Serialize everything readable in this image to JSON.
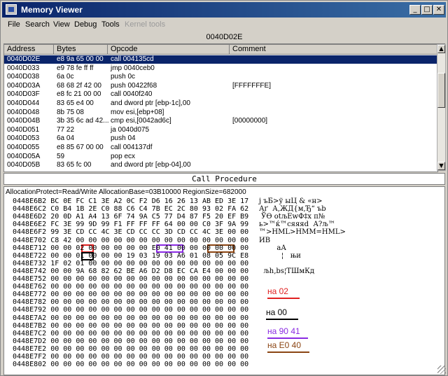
{
  "window": {
    "title": "Memory Viewer",
    "buttons": [
      "_",
      "□",
      "✕"
    ]
  },
  "menu": [
    "File",
    "Search",
    "View",
    "Debug",
    "Tools",
    "Kernel tools"
  ],
  "address_bar": "0040D02E",
  "disasm": {
    "columns": [
      "Address",
      "Bytes",
      "Opcode",
      "Comment"
    ],
    "rows": [
      {
        "addr": "0040D02E",
        "bytes": "e8 9a 65 00 00",
        "op": "call 004135cd",
        "comment": "",
        "selected": true
      },
      {
        "addr": "0040D033",
        "bytes": "e9 78 fe ff ff",
        "op": "jmp 0040ceb0",
        "comment": ""
      },
      {
        "addr": "0040D038",
        "bytes": "6a 0c",
        "op": "push 0c",
        "comment": ""
      },
      {
        "addr": "0040D03A",
        "bytes": "68 68 2f 42 00",
        "op": "push 00422f68",
        "comment": "[FFFFFFFE]"
      },
      {
        "addr": "0040D03F",
        "bytes": "e8 fc 21 00 00",
        "op": "call 0040f240",
        "comment": ""
      },
      {
        "addr": "0040D044",
        "bytes": "83 65 e4 00",
        "op": "and dword ptr [ebp-1c],00",
        "comment": ""
      },
      {
        "addr": "0040D048",
        "bytes": "8b 75 08",
        "op": "mov esi,[ebp+08]",
        "comment": ""
      },
      {
        "addr": "0040D04B",
        "bytes": "3b 35 6c ad 42...",
        "op": "cmp esi,[0042ad6c]",
        "comment": "[00000000]"
      },
      {
        "addr": "0040D051",
        "bytes": "77 22",
        "op": "ja 0040d075",
        "comment": ""
      },
      {
        "addr": "0040D053",
        "bytes": "6a 04",
        "op": "push 04",
        "comment": ""
      },
      {
        "addr": "0040D055",
        "bytes": "e8 85 67 00 00",
        "op": "call 004137df",
        "comment": ""
      },
      {
        "addr": "0040D05A",
        "bytes": "59",
        "op": "pop ecx",
        "comment": ""
      },
      {
        "addr": "0040D05B",
        "bytes": "83 65 fc 00",
        "op": "and dword ptr [ebp-04],00",
        "comment": ""
      }
    ]
  },
  "call_procedure": "Call Procedure",
  "alloc_info": "AllocationProtect=Read/Write  AllocationBase=03B10000 RegionSize=682000",
  "hex_rows": [
    {
      "addr": "0448E6B2",
      "hex": "BC 0E FC C1 3E A2 0C F2 D6 16 26 13 AB ED 3E 17",
      "ascii": "j ъБ>ў ыЦ & «н>"
    },
    {
      "addr": "0448E6C2",
      "hex": "C0 B4 1B 2E C0 88 C6 C4 7B EC 2C 80 93 02 FA 62",
      "ascii": "Аґ  А‚ЖД{м,Ђ“ ъb"
    },
    {
      "addr": "0448E6D2",
      "hex": "20 0D A1 A4 13 6F 74 9A C5 77 D4 87 F5 20 EF B9",
      "ascii": " ЎӨ otљЕwФ‡х п№"
    },
    {
      "addr": "0448E6E2",
      "hex": "FC 3E 99 9D 99 F1 FF FF FF 64 00 00 C0 3F 9A 99",
      "ascii": "ь>™ќ™сяяяd  А?љ™"
    },
    {
      "addr": "0448E6F2",
      "hex": "99 3E CD CC 4C 3E CD CC CC 3D CD CC 4C 3E 00 00",
      "ascii": "™>НМL>НММ=НМL>"
    },
    {
      "addr": "0448E702",
      "hex": "C8 42 00 00 00 00 00 00 00 00 00 00 00 00 00 00",
      "ascii": "ИВ"
    },
    {
      "addr": "0448E712",
      "hex": "00 00 02 00 00 00 00 00 E0 41 00 00 00 00 00 00",
      "ascii": "        аА"
    },
    {
      "addr": "0448E722",
      "hex": "00 00 01 00 00 00 19 03 19 03 A6 01 08 05 9C E8",
      "ascii": "          ¦   њи"
    },
    {
      "addr": "0448E732",
      "hex": "1F 02 01 00 00 00 00 00 00 00 00 00 00 00 00 00",
      "ascii": ""
    },
    {
      "addr": "0448E742",
      "hex": "00 00 9A 68 82 62 BE A6 D2 D8 EC CA E4 00 00 00",
      "ascii": "  љh‚bѕ¦ТШмКд"
    },
    {
      "addr": "0448E752",
      "hex": "00 00 00 00 00 00 00 00 00 00 00 00 00 00 00 00",
      "ascii": ""
    },
    {
      "addr": "0448E762",
      "hex": "00 00 00 00 00 00 00 00 00 00 00 00 00 00 00 00",
      "ascii": ""
    },
    {
      "addr": "0448E772",
      "hex": "00 00 00 00 00 00 00 00 00 00 00 00 00 00 00 00",
      "ascii": ""
    },
    {
      "addr": "0448E782",
      "hex": "00 00 00 00 00 00 00 00 00 00 00 00 00 00 00 00",
      "ascii": ""
    },
    {
      "addr": "0448E792",
      "hex": "00 00 00 00 00 00 00 00 00 00 00 00 00 00 00 00",
      "ascii": ""
    },
    {
      "addr": "0448E7A2",
      "hex": "00 00 00 00 00 00 00 00 00 00 00 00 00 00 00 00",
      "ascii": ""
    },
    {
      "addr": "0448E7B2",
      "hex": "00 00 00 00 00 00 00 00 00 00 00 00 00 00 00 00",
      "ascii": ""
    },
    {
      "addr": "0448E7C2",
      "hex": "00 00 00 00 00 00 00 00 00 00 00 00 00 00 00 00",
      "ascii": ""
    },
    {
      "addr": "0448E7D2",
      "hex": "00 00 00 00 00 00 00 00 00 00 00 00 00 00 00 00",
      "ascii": ""
    },
    {
      "addr": "0448E7E2",
      "hex": "00 00 00 00 00 00 00 00 00 00 00 00 00 00 00 00",
      "ascii": ""
    },
    {
      "addr": "0448E7F2",
      "hex": "00 00 00 00 00 00 00 00 00 00 00 00 00 00 00 00",
      "ascii": ""
    },
    {
      "addr": "0448E802",
      "hex": "00 00 00 00 00 00 00 00 00 00 00 00 00 00 00 00",
      "ascii": ""
    }
  ],
  "annotations": [
    {
      "text": "на 02",
      "color": "#e02020"
    },
    {
      "text": "на 00",
      "color": "#000000"
    },
    {
      "text": "на 90 41",
      "color": "#8a2be2"
    },
    {
      "text": "на E0 40",
      "color": "#8b4513"
    }
  ]
}
